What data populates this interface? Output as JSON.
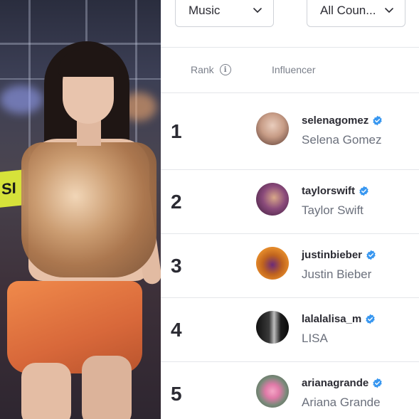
{
  "filters": {
    "category": "Music",
    "country": "All Coun..."
  },
  "table": {
    "columns": {
      "rank": "Rank",
      "influencer": "Influencer"
    },
    "rows": [
      {
        "rank": "1",
        "handle": "selenagomez",
        "name": "Selena Gomez",
        "verified": true
      },
      {
        "rank": "2",
        "handle": "taylorswift",
        "name": "Taylor Swift",
        "verified": true
      },
      {
        "rank": "3",
        "handle": "justinbieber",
        "name": "Justin Bieber",
        "verified": true
      },
      {
        "rank": "4",
        "handle": "lalalalisa_m",
        "name": "LISA",
        "verified": true
      },
      {
        "rank": "5",
        "handle": "arianagrande",
        "name": "Ariana Grande",
        "verified": true
      }
    ]
  },
  "colors": {
    "verified": "#3897f0",
    "text": "#2b2b33",
    "muted": "#6b707c"
  },
  "icons": {
    "dropdown": "chevron-down-icon",
    "info": "info-icon",
    "verified": "verified-badge-icon"
  }
}
